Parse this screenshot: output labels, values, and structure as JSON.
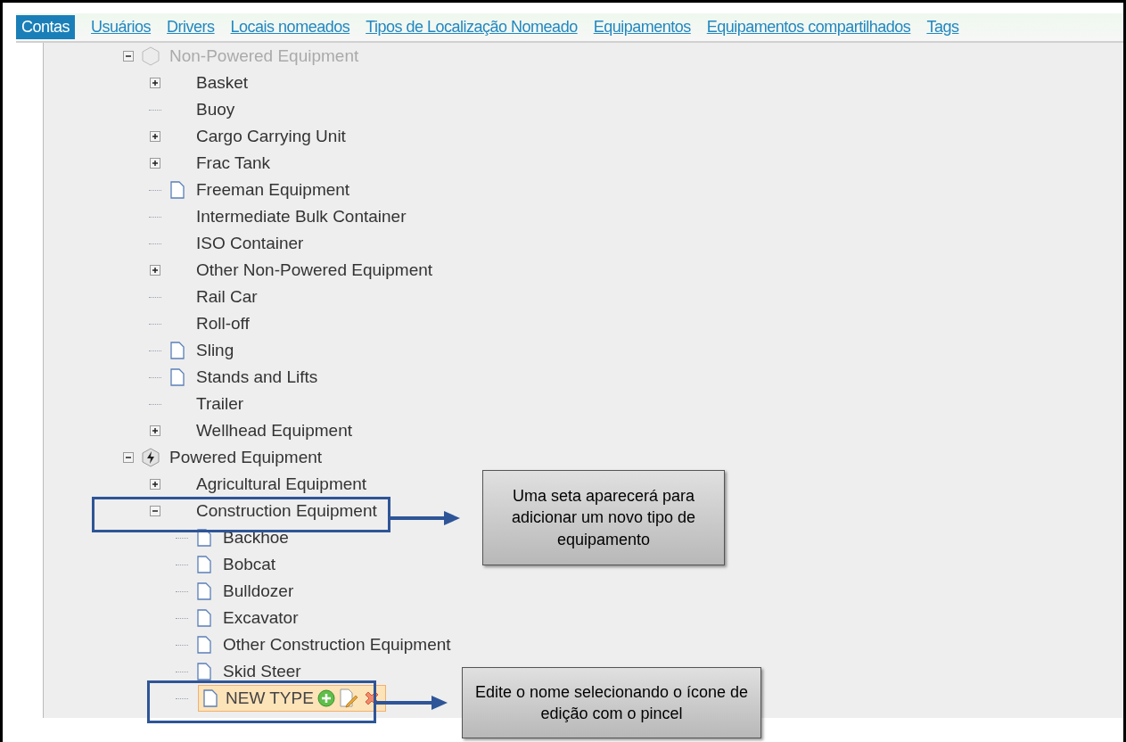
{
  "nav": {
    "tabs": [
      {
        "label": "Contas",
        "selected": true
      },
      {
        "label": "Usuários",
        "selected": false
      },
      {
        "label": "Drivers",
        "selected": false
      },
      {
        "label": "Locais nomeados",
        "selected": false
      },
      {
        "label": "Tipos de Localização Nomeado",
        "selected": false
      },
      {
        "label": "Equipamentos",
        "selected": false
      },
      {
        "label": "Equipamentos compartilhados",
        "selected": false
      },
      {
        "label": "Tags",
        "selected": false
      }
    ]
  },
  "tree": [
    {
      "label": "Non-Powered Equipment",
      "kind": "non-powered",
      "expanded": true,
      "children": [
        {
          "label": "Basket",
          "kind": "folder",
          "expanded": false
        },
        {
          "label": "Buoy",
          "kind": "leaf"
        },
        {
          "label": "Cargo Carrying Unit",
          "kind": "folder",
          "expanded": false
        },
        {
          "label": "Frac Tank",
          "kind": "folder",
          "expanded": false
        },
        {
          "label": "Freeman Equipment",
          "kind": "page"
        },
        {
          "label": "Intermediate Bulk Container",
          "kind": "leaf"
        },
        {
          "label": "ISO Container",
          "kind": "leaf"
        },
        {
          "label": "Other Non-Powered Equipment",
          "kind": "folder",
          "expanded": false
        },
        {
          "label": "Rail Car",
          "kind": "leaf"
        },
        {
          "label": "Roll-off",
          "kind": "leaf"
        },
        {
          "label": "Sling",
          "kind": "page"
        },
        {
          "label": "Stands and Lifts",
          "kind": "page"
        },
        {
          "label": "Trailer",
          "kind": "leaf"
        },
        {
          "label": "Wellhead Equipment",
          "kind": "folder",
          "expanded": false
        }
      ]
    },
    {
      "label": "Powered Equipment",
      "kind": "powered",
      "expanded": true,
      "children": [
        {
          "label": "Agricultural Equipment",
          "kind": "folder",
          "expanded": false
        },
        {
          "label": "Construction Equipment",
          "kind": "folder",
          "expanded": true,
          "children": [
            {
              "label": "Backhoe",
              "kind": "page"
            },
            {
              "label": "Bobcat",
              "kind": "page"
            },
            {
              "label": "Bulldozer",
              "kind": "page"
            },
            {
              "label": "Excavator",
              "kind": "page"
            },
            {
              "label": "Other Construction Equipment",
              "kind": "page"
            },
            {
              "label": "Skid Steer",
              "kind": "page"
            },
            {
              "label": "NEW TYPE",
              "kind": "page",
              "selected": true
            }
          ]
        }
      ]
    }
  ],
  "callouts": [
    {
      "text": "Uma seta aparecerá para adicionar um novo tipo de equipamento"
    },
    {
      "text": "Edite o nome selecionando o ícone de edição com o pincel"
    }
  ]
}
